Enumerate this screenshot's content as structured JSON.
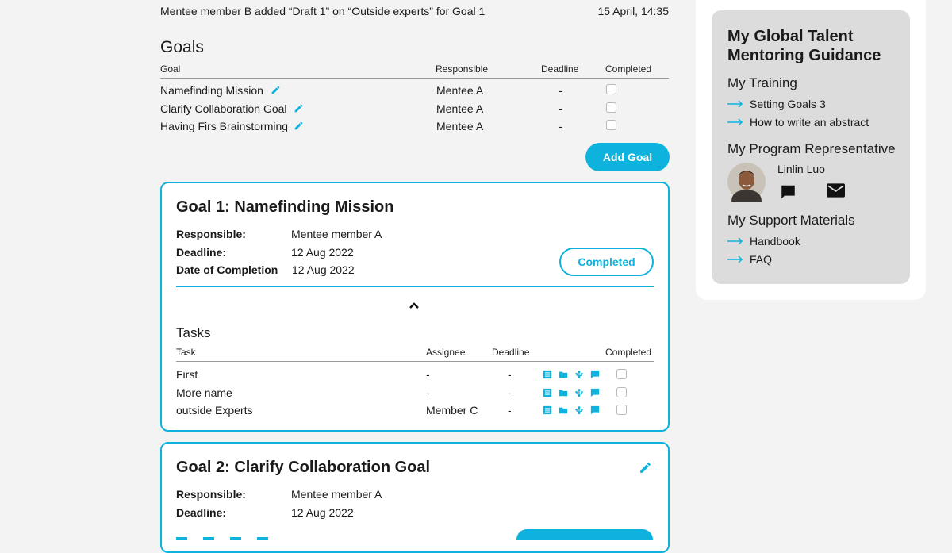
{
  "activity": {
    "text": "Mentee member B added “Draft 1” on “Outside experts” for Goal 1",
    "time": "15 April, 14:35"
  },
  "goals": {
    "title": "Goals",
    "headers": {
      "goal": "Goal",
      "responsible": "Responsible",
      "deadline": "Deadline",
      "completed": "Completed"
    },
    "rows": [
      {
        "name": "Namefinding Mission",
        "responsible": "Mentee A",
        "deadline": "-",
        "completed": false
      },
      {
        "name": "Clarify Collaboration Goal",
        "responsible": "Mentee A",
        "deadline": "-",
        "completed": false
      },
      {
        "name": "Having Firs Brainstorming",
        "responsible": "Mentee A",
        "deadline": "-",
        "completed": false
      }
    ],
    "add_label": "Add Goal"
  },
  "goal1": {
    "title": "Goal 1: Namefinding Mission",
    "responsible_label": "Responsible:",
    "responsible": "Mentee member A",
    "deadline_label": "Deadline:",
    "deadline": "12 Aug 2022",
    "completion_label": "Date of Completion",
    "completion": "12 Aug 2022",
    "status": "Completed",
    "tasks": {
      "title": "Tasks",
      "headers": {
        "task": "Task",
        "assignee": "Assignee",
        "deadline": "Deadline",
        "completed": "Completed"
      },
      "rows": [
        {
          "name": "First",
          "assignee": "-",
          "deadline": "-"
        },
        {
          "name": "More name",
          "assignee": "-",
          "deadline": "-"
        },
        {
          "name": "outside Experts",
          "assignee": "Member C",
          "deadline": "-"
        }
      ]
    }
  },
  "goal2": {
    "title": "Goal 2: Clarify Collaboration Goal",
    "responsible_label": "Responsible:",
    "responsible": "Mentee member A",
    "deadline_label": "Deadline:",
    "deadline": "12 Aug 2022"
  },
  "sidebar": {
    "title": "My Global Talent Mentoring Guidance",
    "training": {
      "title": "My Training",
      "links": [
        "Setting Goals 3",
        "How to write an abstract"
      ]
    },
    "rep": {
      "title": "My Program Representative",
      "name": "Linlin Luo"
    },
    "support": {
      "title": "My Support Materials",
      "links": [
        "Handbook",
        "FAQ"
      ]
    }
  },
  "colors": {
    "accent": "#0db2dd",
    "background": "#f3f3f3",
    "panel": "#dcdcdc"
  },
  "icons": [
    "pencil-icon",
    "chevron-up-icon",
    "list-icon",
    "folder-icon",
    "tree-icon",
    "comment-icon",
    "chat-icon",
    "mail-icon",
    "arrow-right-icon"
  ]
}
